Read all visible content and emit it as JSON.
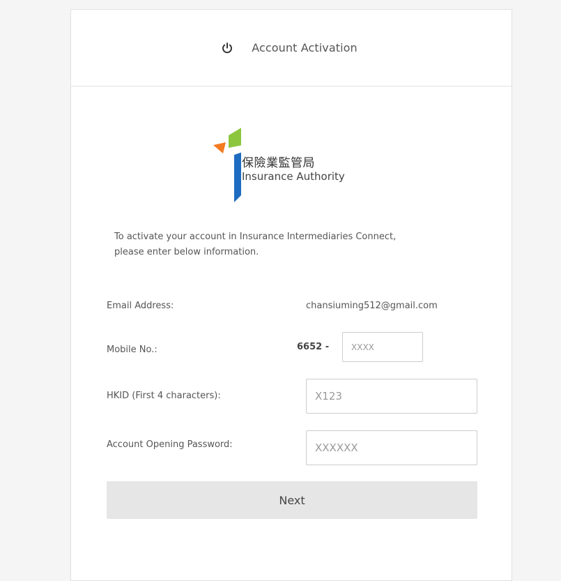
{
  "header": {
    "icon": "power-icon",
    "title": "Account Activation"
  },
  "logo": {
    "chinese_name": "保險業監管局",
    "english_name": "Insurance Authority",
    "colors": {
      "orange": "#f47b20",
      "green": "#8cc63f",
      "blue": "#1e6cc1"
    }
  },
  "intro": {
    "line1": "To activate your account in Insurance Intermediaries Connect,",
    "line2": "please enter below information."
  },
  "form": {
    "email_label": "Email Address:",
    "email_value": "chansiuming512@gmail.com",
    "mobile_label": "Mobile No.:",
    "mobile_prefix": "6652 -",
    "mobile_placeholder": "XXXX",
    "hkid_label": "HKID (First 4 characters):",
    "hkid_placeholder": "X123",
    "password_label": "Account Opening Password:",
    "password_placeholder": "XXXXXX"
  },
  "actions": {
    "next_label": "Next"
  }
}
